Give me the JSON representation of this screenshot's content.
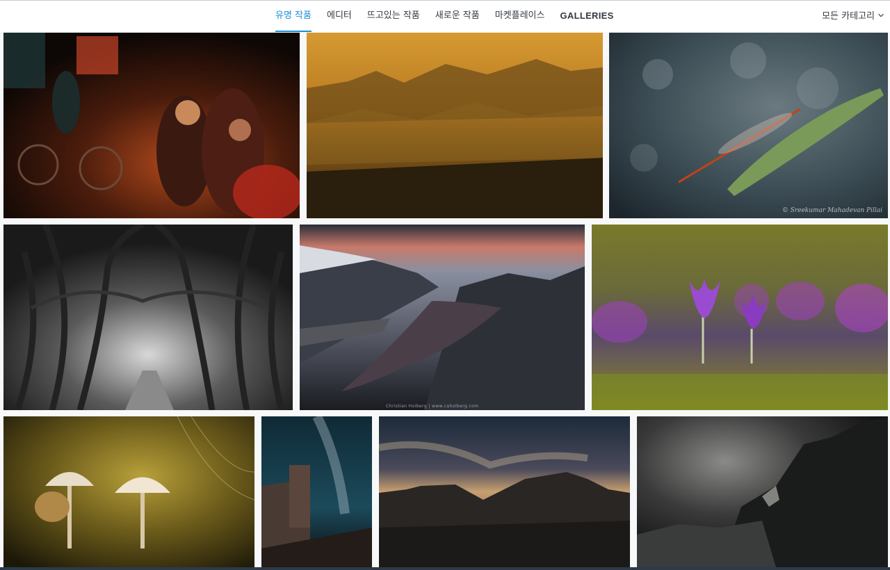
{
  "nav": {
    "tabs": [
      {
        "label": "유명 작품",
        "active": true
      },
      {
        "label": "에디터"
      },
      {
        "label": "뜨고있는 작품"
      },
      {
        "label": "새로운 작품"
      },
      {
        "label": "마켓플레이스"
      },
      {
        "label": "GALLERIES"
      }
    ],
    "category_label": "모든 카테고리",
    "accent_color": "#1a8fd6"
  },
  "gallery": {
    "photo_captions": {
      "dragonfly": "© Sreekumar Mahadevan Pillai",
      "fjord": "Christian Hoiberg | www.cahoiberg.com"
    }
  },
  "icons": {
    "category_dropdown": "chevron-down-icon"
  }
}
